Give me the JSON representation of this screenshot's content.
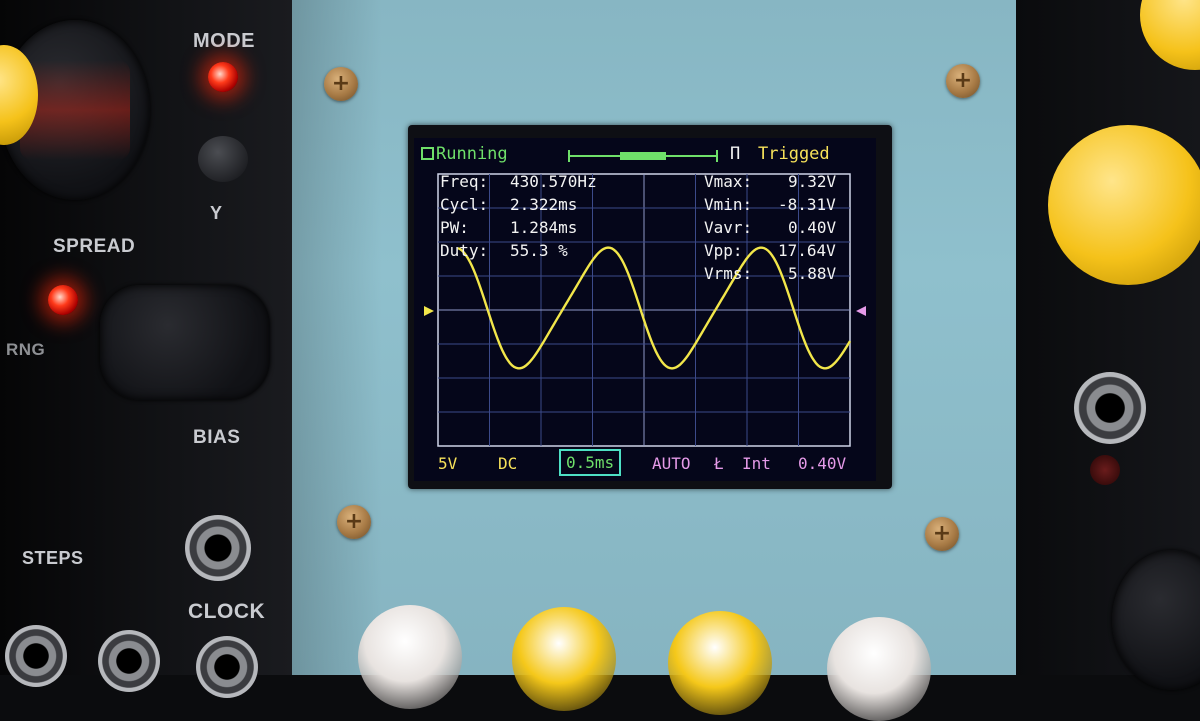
{
  "left_module": {
    "labels": {
      "mode": "MODE",
      "y": "Y",
      "spread": "SPREAD",
      "rng": "RNG",
      "bias": "BIAS",
      "steps": "STEPS",
      "clock": "CLOCK"
    }
  },
  "scope": {
    "status": "Running",
    "trigger_state": "Trigged",
    "trigger_edge_symbol": "Π",
    "measurements_left": [
      {
        "label": "Freq:",
        "value": "430.570Hz"
      },
      {
        "label": "Cycl:",
        "value": "2.322ms"
      },
      {
        "label": "PW:",
        "value": "1.284ms"
      },
      {
        "label": "Duty:",
        "value": "55.3 %"
      }
    ],
    "measurements_right": [
      {
        "label": "Vmax:",
        "value": "9.32V"
      },
      {
        "label": "Vmin:",
        "value": "-8.31V"
      },
      {
        "label": "Vavr:",
        "value": "0.40V"
      },
      {
        "label": "Vpp:",
        "value": "17.64V"
      },
      {
        "label": "Vrms:",
        "value": "5.88V"
      }
    ],
    "bottom_bar": {
      "volts_div": "5V",
      "coupling": "DC",
      "time_div": "0.5ms",
      "trigger_mode": "AUTO",
      "trigger_slope": "Ł",
      "trigger_source": "Int",
      "trigger_level": "0.40V"
    },
    "colors": {
      "screen": "#05061a",
      "grid": "#3c4a8a",
      "trace": "#f2e64a",
      "status_green": "#6fe06a",
      "trig_yellow": "#f7e25a",
      "bottom_magenta": "#e59ae8"
    }
  },
  "buttons": {
    "colors": [
      "#e8e3e0",
      "#f5c81a",
      "#f5c81a",
      "#e8e3e0"
    ]
  }
}
